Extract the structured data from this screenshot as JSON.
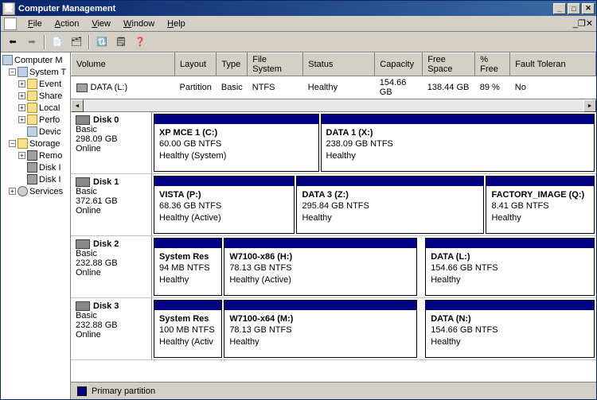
{
  "window": {
    "title": "Computer Management"
  },
  "menu": {
    "file": "File",
    "action": "Action",
    "view": "View",
    "window": "Window",
    "help": "Help"
  },
  "tree": {
    "root": "Computer M",
    "system": "System T",
    "event": "Event",
    "share": "Share",
    "local": "Local",
    "perfo": "Perfo",
    "devic": "Devic",
    "storage": "Storage",
    "remo": "Remo",
    "diskd": "Disk I",
    "diskm": "Disk I",
    "services": "Services"
  },
  "grid": {
    "cols": {
      "volume": "Volume",
      "layout": "Layout",
      "type": "Type",
      "fs": "File System",
      "status": "Status",
      "capacity": "Capacity",
      "free": "Free Space",
      "pctfree": "% Free",
      "fault": "Fault Toleran"
    },
    "rows": [
      {
        "volume": "DATA (L:)",
        "layout": "Partition",
        "type": "Basic",
        "fs": "NTFS",
        "status": "Healthy",
        "capacity": "154.66 GB",
        "free": "138.44 GB",
        "pctfree": "89 %",
        "fault": "No"
      }
    ]
  },
  "disks": [
    {
      "name": "Disk 0",
      "type": "Basic",
      "size": "298.09 GB",
      "status": "Online",
      "partitions": [
        {
          "name": "XP MCE 1  (C:)",
          "size": "60.00 GB NTFS",
          "status": "Healthy (System)",
          "flex": 3
        },
        {
          "name": "DATA 1  (X:)",
          "size": "238.09 GB NTFS",
          "status": "Healthy",
          "flex": 5
        }
      ]
    },
    {
      "name": "Disk 1",
      "type": "Basic",
      "size": "372.61 GB",
      "status": "Online",
      "partitions": [
        {
          "name": "VISTA  (P:)",
          "size": "68.36 GB NTFS",
          "status": "Healthy (Active)",
          "flex": 3
        },
        {
          "name": "DATA 3  (Z:)",
          "size": "295.84 GB NTFS",
          "status": "Healthy",
          "flex": 4
        },
        {
          "name": "FACTORY_IMAGE  (Q:)",
          "size": "8.41 GB NTFS",
          "status": "Healthy",
          "flex": 2.3
        }
      ]
    },
    {
      "name": "Disk 2",
      "type": "Basic",
      "size": "232.88 GB",
      "status": "Online",
      "partitions": [
        {
          "name": "System Res",
          "size": "94 MB NTFS",
          "status": "Healthy",
          "flex": 1.4
        },
        {
          "name": "W7100-x86  (H:)",
          "size": "78.13 GB NTFS",
          "status": "Healthy (Active)",
          "flex": 4
        },
        {
          "name": "",
          "size": "",
          "status": "",
          "flex": 0.1,
          "spacer": true
        },
        {
          "name": "DATA  (L:)",
          "size": "154.66 GB NTFS",
          "status": "Healthy",
          "flex": 3.5
        }
      ]
    },
    {
      "name": "Disk 3",
      "type": "Basic",
      "size": "232.88 GB",
      "status": "Online",
      "partitions": [
        {
          "name": "System Res",
          "size": "100 MB NTFS",
          "status": "Healthy (Activ",
          "flex": 1.4
        },
        {
          "name": "W7100-x64  (M:)",
          "size": "78.13 GB NTFS",
          "status": "Healthy",
          "flex": 4
        },
        {
          "name": "",
          "size": "",
          "status": "",
          "flex": 0.1,
          "spacer": true
        },
        {
          "name": "DATA  (N:)",
          "size": "154.66 GB NTFS",
          "status": "Healthy",
          "flex": 3.5
        }
      ]
    }
  ],
  "legend": {
    "primary": "Primary partition"
  }
}
